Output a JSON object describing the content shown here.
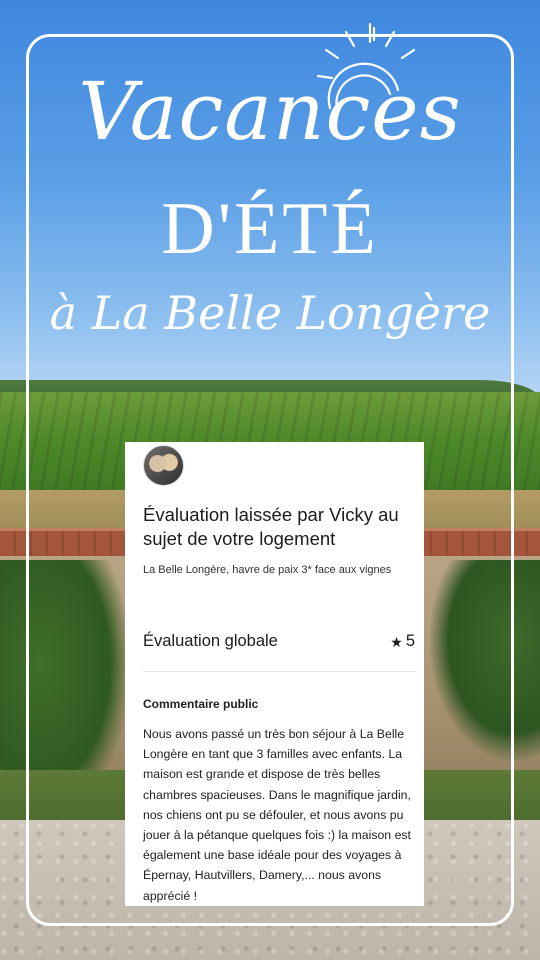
{
  "poster": {
    "title_line1": "Vacances",
    "title_line2": "D'ÉTÉ",
    "title_line3": "à La Belle Longère",
    "icon": "sun-icon",
    "frame_color": "#ffffff"
  },
  "review": {
    "avatar": "avatar",
    "title": "Évaluation laissée par Vicky au sujet de votre logement",
    "listing_name": "La Belle Longère, havre de paix 3* face aux vignes",
    "overall_label": "Évaluation globale",
    "star_icon": "star-icon",
    "overall_value": "5",
    "comment_label": "Commentaire public",
    "comment_text": "Nous avons passé un très bon séjour à La Belle Longère en tant que 3 familles avec enfants. La maison est grande et dispose de très belles chambres spacieuses. Dans le magnifique jardin, nos chiens ont pu se défouler, et nous avons pu jouer à la pétanque quelques fois :) la maison est également une base idéale pour des voyages à Épernay, Hautvillers, Damery,... nous avons apprécié !"
  }
}
